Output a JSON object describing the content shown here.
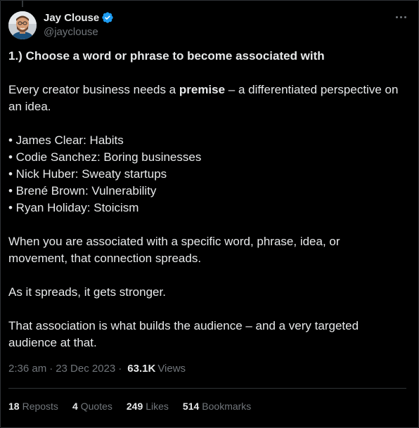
{
  "author": {
    "display_name": "Jay Clouse",
    "handle": "@jayclouse",
    "verified_icon": "verified-badge-icon",
    "verified_color": "#1d9bf0"
  },
  "menu": {
    "more_icon": "more-horizontal-icon"
  },
  "tweet": {
    "heading": "1.) Choose a word or phrase to become associated with",
    "para1_before": "Every creator business needs a ",
    "para1_bold": "premise",
    "para1_after": " – a differentiated perspective on an idea.",
    "bullets": [
      "• James Clear: Habits",
      "• Codie Sanchez: Boring businesses",
      "• Nick Huber: Sweaty startups",
      "• Brené Brown: Vulnerability",
      "• Ryan Holiday: Stoicism"
    ],
    "para2": "When you are associated with a specific word, phrase, idea, or movement, that connection spreads.",
    "para3": "As it spreads, it gets stronger.",
    "para4": "That association is what builds the audience – and a very targeted audience at that."
  },
  "meta": {
    "time": "2:36 am",
    "separator": "·",
    "date": "23 Dec 2023",
    "views_count": "63.1K",
    "views_label": "Views"
  },
  "stats": {
    "reposts_count": "18",
    "reposts_label": "Reposts",
    "quotes_count": "4",
    "quotes_label": "Quotes",
    "likes_count": "249",
    "likes_label": "Likes",
    "bookmarks_count": "514",
    "bookmarks_label": "Bookmarks"
  },
  "colors": {
    "background": "#000000",
    "text_primary": "#e7e9ea",
    "text_secondary": "#71767b",
    "border": "#2f3336"
  }
}
